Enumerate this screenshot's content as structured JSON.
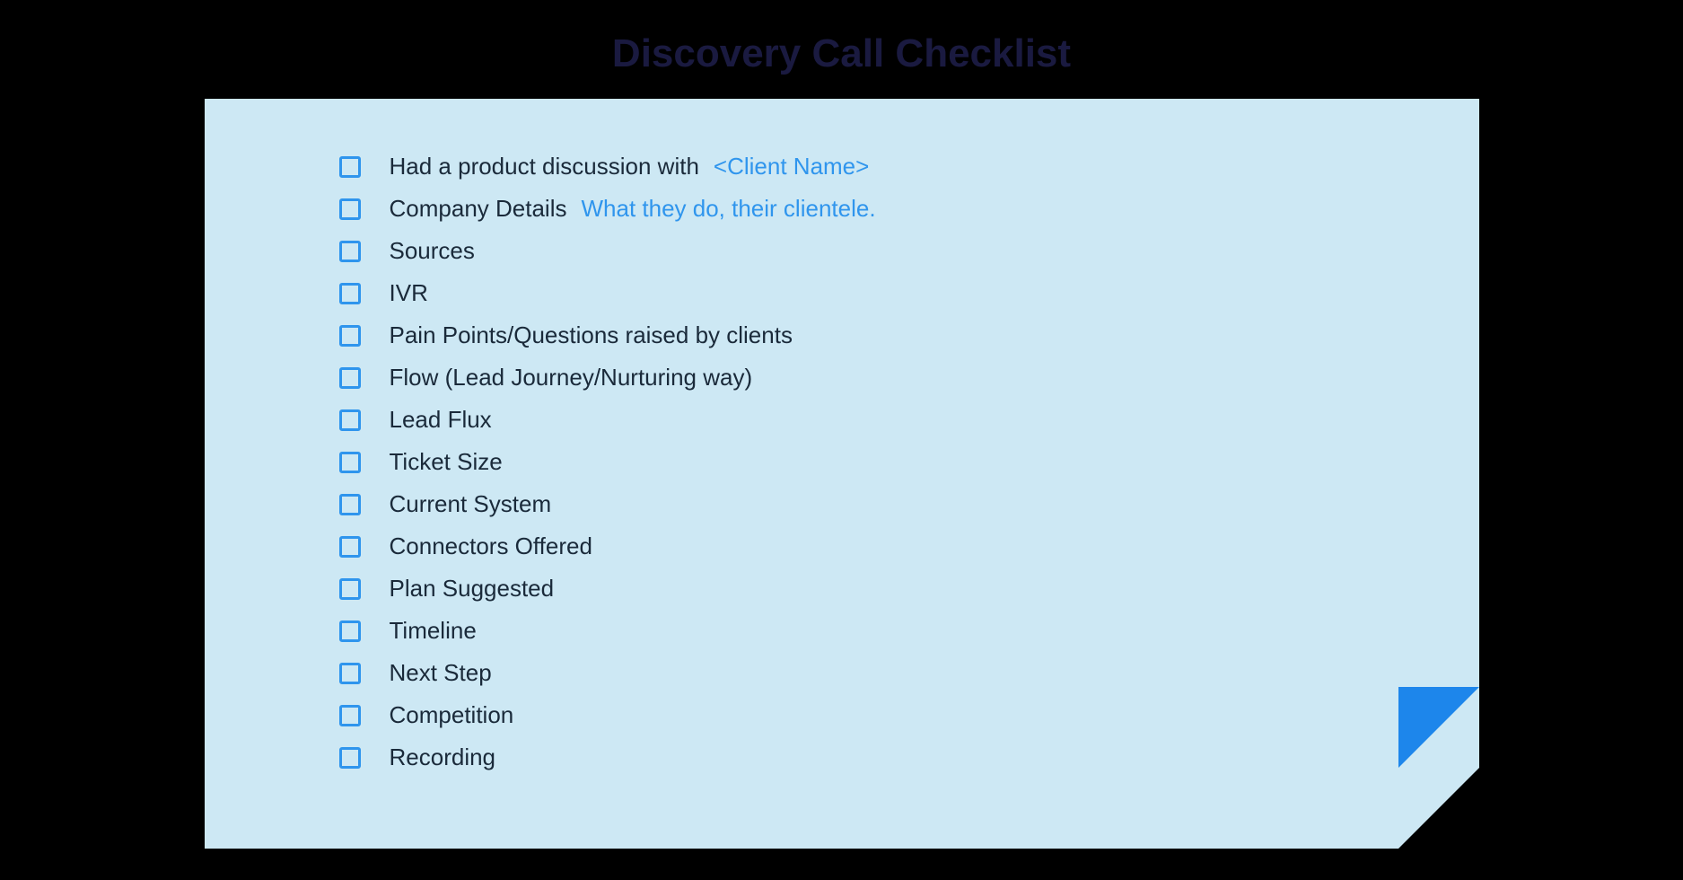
{
  "title": "Discovery Call Checklist",
  "items": [
    {
      "label": "Had a product discussion with",
      "hint": "<Client Name>"
    },
    {
      "label": "Company Details",
      "hint": "What they do, their clientele."
    },
    {
      "label": "Sources",
      "hint": ""
    },
    {
      "label": "IVR",
      "hint": ""
    },
    {
      "label": "Pain Points/Questions raised by clients",
      "hint": ""
    },
    {
      "label": "Flow (Lead Journey/Nurturing way)",
      "hint": ""
    },
    {
      "label": "Lead Flux",
      "hint": ""
    },
    {
      "label": "Ticket Size",
      "hint": ""
    },
    {
      "label": "Current System",
      "hint": ""
    },
    {
      "label": "Connectors Offered",
      "hint": ""
    },
    {
      "label": "Plan Suggested",
      "hint": ""
    },
    {
      "label": "Timeline",
      "hint": ""
    },
    {
      "label": "Next Step",
      "hint": ""
    },
    {
      "label": "Competition",
      "hint": ""
    },
    {
      "label": "Recording",
      "hint": ""
    }
  ]
}
